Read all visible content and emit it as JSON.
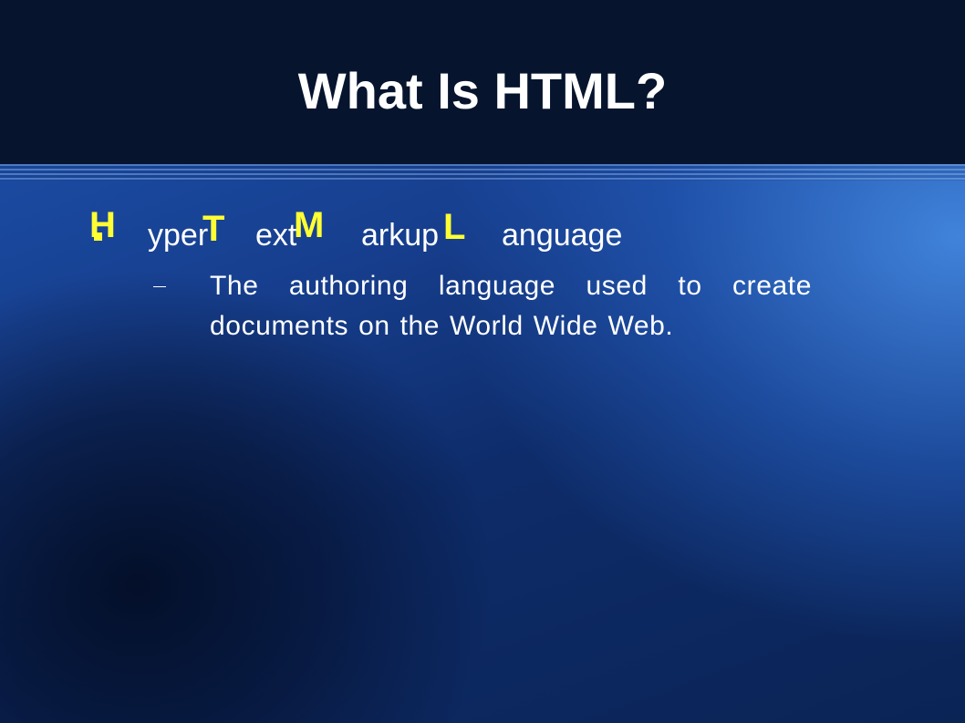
{
  "slide": {
    "title": "What Is HTML?",
    "acronym": {
      "letters": [
        "H",
        "T",
        "M",
        "L"
      ],
      "words": [
        "yper",
        "ext",
        "arkup",
        "anguage"
      ]
    },
    "sub_bullet_text": "The authoring language used to create documents on the World Wide Web."
  },
  "colors": {
    "header_background": "#06142e",
    "slide_blue": "#1d54b0",
    "accent_letters": "#ffff33",
    "text": "#ffffff"
  }
}
